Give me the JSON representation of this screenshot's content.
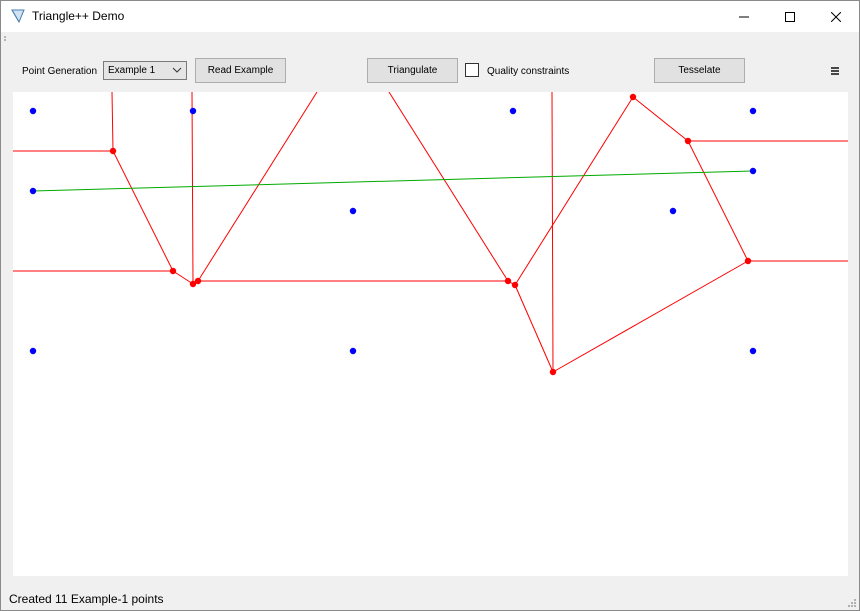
{
  "window": {
    "title": "Triangle++ Demo",
    "icon": "triangle-app-icon",
    "controls": {
      "minimize": "—",
      "maximize": "☐",
      "close": "✕"
    }
  },
  "toolbar": {
    "point_generation_label": "Point Generation",
    "example_select_value": "Example 1",
    "read_example_label": "Read Example",
    "triangulate_label": "Triangulate",
    "quality_constraints_label": "Quality constraints",
    "quality_constraints_checked": false,
    "tesselate_label": "Tesselate",
    "menu_icon": "hamburger-menu-icon"
  },
  "canvas": {
    "input_points_color": "#0000ff",
    "voronoi_color": "#ff0000",
    "segment_color": "#00aa00"
  },
  "status": {
    "text": "Created 11 Example-1 points"
  }
}
